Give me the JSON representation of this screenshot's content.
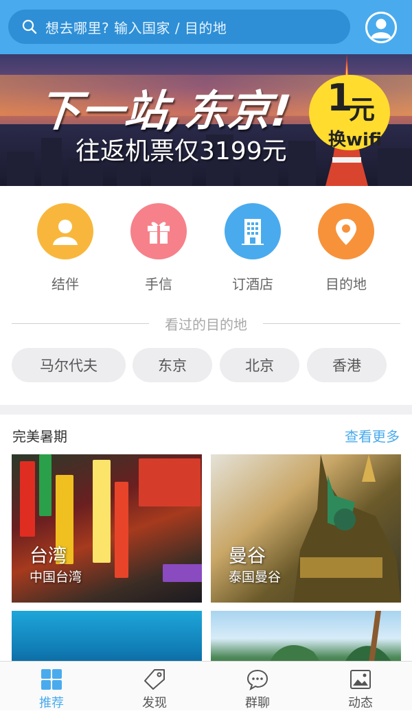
{
  "search": {
    "placeholder": "想去哪里? 输入国家 / 目的地"
  },
  "banner": {
    "headline": "下一站,东京!",
    "subline": "往返机票仅3199元",
    "badge_number": "1",
    "badge_unit": "元",
    "badge_text": "换wifi"
  },
  "categories": [
    {
      "label": "结伴",
      "icon": "companion-icon",
      "color": "#f8b73c"
    },
    {
      "label": "手信",
      "icon": "gift-icon",
      "color": "#f6818a"
    },
    {
      "label": "订酒店",
      "icon": "hotel-icon",
      "color": "#49abed"
    },
    {
      "label": "目的地",
      "icon": "location-pin-icon",
      "color": "#f7923a"
    }
  ],
  "history": {
    "title": "看过的目的地",
    "chips": [
      "马尔代夫",
      "东京",
      "北京",
      "香港"
    ]
  },
  "section": {
    "title": "完美暑期",
    "more": "查看更多",
    "cards": [
      {
        "name": "台湾",
        "sub": "中国台湾"
      },
      {
        "name": "曼谷",
        "sub": "泰国曼谷"
      }
    ]
  },
  "nav": [
    {
      "label": "推荐",
      "icon": "grid-icon",
      "active": true
    },
    {
      "label": "发现",
      "icon": "tag-icon",
      "active": false
    },
    {
      "label": "群聊",
      "icon": "chat-icon",
      "active": false
    },
    {
      "label": "动态",
      "icon": "picture-icon",
      "active": false
    }
  ],
  "colors": {
    "primary": "#49abed",
    "search_bg": "#2e8fd6",
    "badge": "#ffdc2e"
  }
}
